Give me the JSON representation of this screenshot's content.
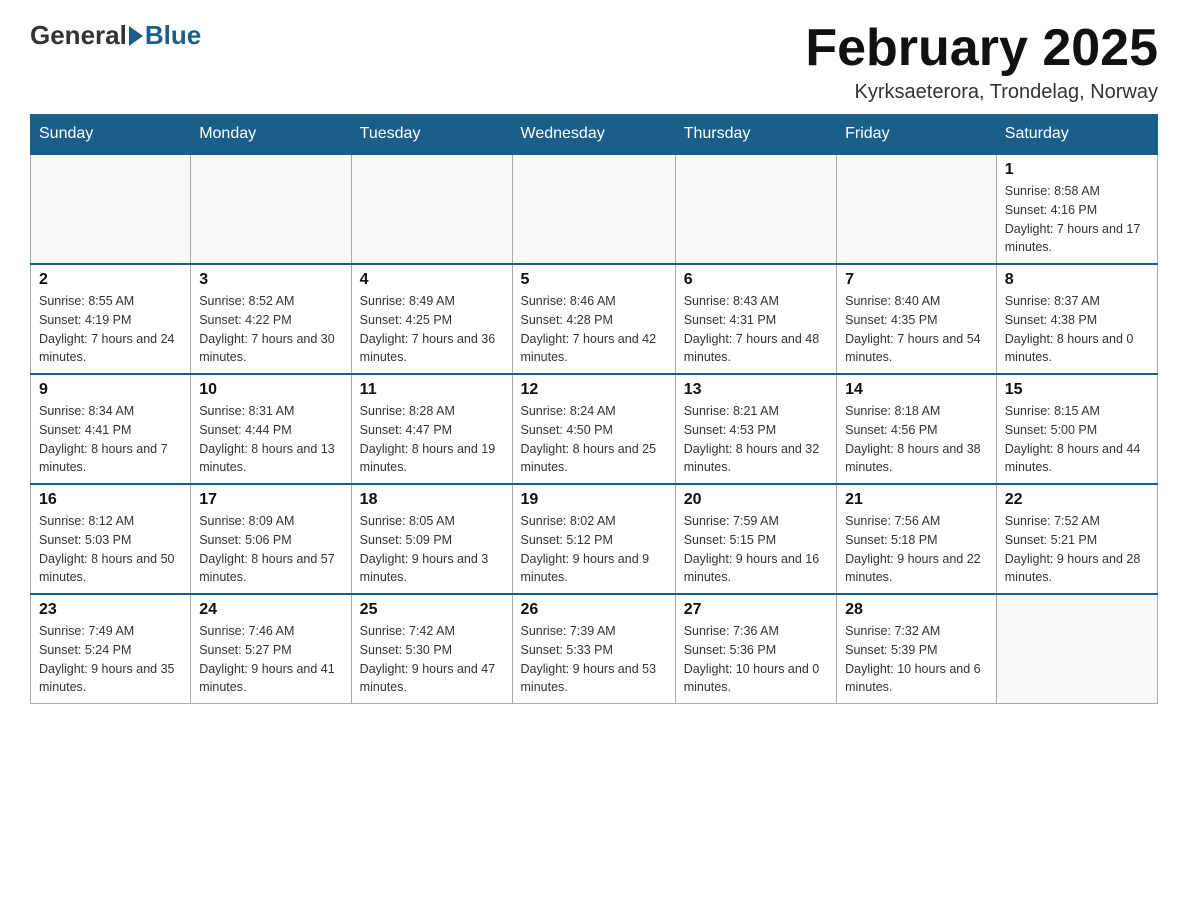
{
  "logo": {
    "general": "General",
    "blue": "Blue"
  },
  "title": {
    "month": "February 2025",
    "location": "Kyrksaeterora, Trondelag, Norway"
  },
  "days_of_week": [
    "Sunday",
    "Monday",
    "Tuesday",
    "Wednesday",
    "Thursday",
    "Friday",
    "Saturday"
  ],
  "weeks": [
    [
      {
        "day": "",
        "info": ""
      },
      {
        "day": "",
        "info": ""
      },
      {
        "day": "",
        "info": ""
      },
      {
        "day": "",
        "info": ""
      },
      {
        "day": "",
        "info": ""
      },
      {
        "day": "",
        "info": ""
      },
      {
        "day": "1",
        "info": "Sunrise: 8:58 AM\nSunset: 4:16 PM\nDaylight: 7 hours and 17 minutes."
      }
    ],
    [
      {
        "day": "2",
        "info": "Sunrise: 8:55 AM\nSunset: 4:19 PM\nDaylight: 7 hours and 24 minutes."
      },
      {
        "day": "3",
        "info": "Sunrise: 8:52 AM\nSunset: 4:22 PM\nDaylight: 7 hours and 30 minutes."
      },
      {
        "day": "4",
        "info": "Sunrise: 8:49 AM\nSunset: 4:25 PM\nDaylight: 7 hours and 36 minutes."
      },
      {
        "day": "5",
        "info": "Sunrise: 8:46 AM\nSunset: 4:28 PM\nDaylight: 7 hours and 42 minutes."
      },
      {
        "day": "6",
        "info": "Sunrise: 8:43 AM\nSunset: 4:31 PM\nDaylight: 7 hours and 48 minutes."
      },
      {
        "day": "7",
        "info": "Sunrise: 8:40 AM\nSunset: 4:35 PM\nDaylight: 7 hours and 54 minutes."
      },
      {
        "day": "8",
        "info": "Sunrise: 8:37 AM\nSunset: 4:38 PM\nDaylight: 8 hours and 0 minutes."
      }
    ],
    [
      {
        "day": "9",
        "info": "Sunrise: 8:34 AM\nSunset: 4:41 PM\nDaylight: 8 hours and 7 minutes."
      },
      {
        "day": "10",
        "info": "Sunrise: 8:31 AM\nSunset: 4:44 PM\nDaylight: 8 hours and 13 minutes."
      },
      {
        "day": "11",
        "info": "Sunrise: 8:28 AM\nSunset: 4:47 PM\nDaylight: 8 hours and 19 minutes."
      },
      {
        "day": "12",
        "info": "Sunrise: 8:24 AM\nSunset: 4:50 PM\nDaylight: 8 hours and 25 minutes."
      },
      {
        "day": "13",
        "info": "Sunrise: 8:21 AM\nSunset: 4:53 PM\nDaylight: 8 hours and 32 minutes."
      },
      {
        "day": "14",
        "info": "Sunrise: 8:18 AM\nSunset: 4:56 PM\nDaylight: 8 hours and 38 minutes."
      },
      {
        "day": "15",
        "info": "Sunrise: 8:15 AM\nSunset: 5:00 PM\nDaylight: 8 hours and 44 minutes."
      }
    ],
    [
      {
        "day": "16",
        "info": "Sunrise: 8:12 AM\nSunset: 5:03 PM\nDaylight: 8 hours and 50 minutes."
      },
      {
        "day": "17",
        "info": "Sunrise: 8:09 AM\nSunset: 5:06 PM\nDaylight: 8 hours and 57 minutes."
      },
      {
        "day": "18",
        "info": "Sunrise: 8:05 AM\nSunset: 5:09 PM\nDaylight: 9 hours and 3 minutes."
      },
      {
        "day": "19",
        "info": "Sunrise: 8:02 AM\nSunset: 5:12 PM\nDaylight: 9 hours and 9 minutes."
      },
      {
        "day": "20",
        "info": "Sunrise: 7:59 AM\nSunset: 5:15 PM\nDaylight: 9 hours and 16 minutes."
      },
      {
        "day": "21",
        "info": "Sunrise: 7:56 AM\nSunset: 5:18 PM\nDaylight: 9 hours and 22 minutes."
      },
      {
        "day": "22",
        "info": "Sunrise: 7:52 AM\nSunset: 5:21 PM\nDaylight: 9 hours and 28 minutes."
      }
    ],
    [
      {
        "day": "23",
        "info": "Sunrise: 7:49 AM\nSunset: 5:24 PM\nDaylight: 9 hours and 35 minutes."
      },
      {
        "day": "24",
        "info": "Sunrise: 7:46 AM\nSunset: 5:27 PM\nDaylight: 9 hours and 41 minutes."
      },
      {
        "day": "25",
        "info": "Sunrise: 7:42 AM\nSunset: 5:30 PM\nDaylight: 9 hours and 47 minutes."
      },
      {
        "day": "26",
        "info": "Sunrise: 7:39 AM\nSunset: 5:33 PM\nDaylight: 9 hours and 53 minutes."
      },
      {
        "day": "27",
        "info": "Sunrise: 7:36 AM\nSunset: 5:36 PM\nDaylight: 10 hours and 0 minutes."
      },
      {
        "day": "28",
        "info": "Sunrise: 7:32 AM\nSunset: 5:39 PM\nDaylight: 10 hours and 6 minutes."
      },
      {
        "day": "",
        "info": ""
      }
    ]
  ]
}
